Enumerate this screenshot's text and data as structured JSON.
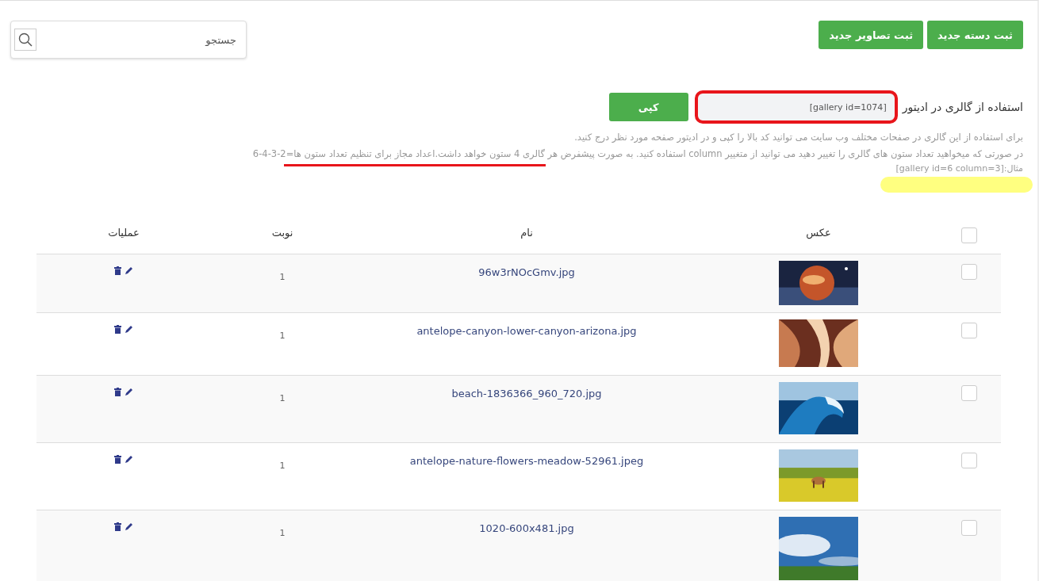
{
  "toolbar": {
    "buttons": [
      {
        "label": "ثبت دسته جدید"
      },
      {
        "label": "ثبت تصاویر جدید"
      }
    ],
    "search": {
      "placeholder": "جستجو"
    }
  },
  "embed": {
    "label": "استفاده از گالری در ادیتور",
    "code": "[gallery id=1074]",
    "copy_button": "کپی",
    "highlighted": true,
    "help": [
      "برای استفاده از این گالری در صفحات مختلف وب سایت می توانید کد بالا را کپی و در ادیتور صفحه مورد نظر درج کنید.",
      "در صورتی که میخواهید تعداد ستون های گالری را تغییر دهید می توانید از متغییر column استفاده کنید. به صورت پیشفرض هر گالری 4 ستون خواهد داشت.اعداد مجاز برای تنظیم تعداد ستون ها=2-3-4-6"
    ],
    "example": "مثال:[gallery id=6 column=3]"
  },
  "table": {
    "select_all": {
      "checked": false
    },
    "columns": [
      "عکس",
      "نام",
      "نوبت",
      "عملیات"
    ],
    "rows": [
      {
        "checked": false,
        "name": "96w3rNOcGmv.jpg",
        "order": "1"
      },
      {
        "checked": false,
        "name": "antelope-canyon-lower-canyon-arizona.jpg",
        "order": "1"
      },
      {
        "checked": false,
        "name": "beach-1836366_960_720.jpg",
        "order": "1"
      },
      {
        "checked": false,
        "name": "antelope-nature-flowers-meadow-52961.jpeg",
        "order": "1"
      },
      {
        "checked": false,
        "name": "1020-600x481.jpg",
        "order": "1"
      }
    ]
  }
}
